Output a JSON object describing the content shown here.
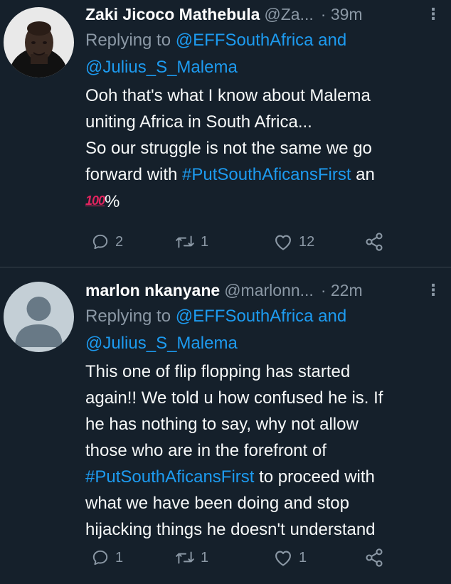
{
  "tweets": [
    {
      "name": "Zaki Jicoco Mathebula",
      "handle": "@Za...",
      "time": "· 39m",
      "more": "⋮",
      "replying_prefix": "Replying to ",
      "replying_to_1": "@EFFSouthAfrica",
      "replying_and": " and",
      "replying_to_2": "@Julius_S_Malema",
      "text_line_1": "Ooh that's what I know about Malema",
      "text_line_2": "uniting Africa in South Africa...",
      "text_line_3": "So our struggle is not the same we go",
      "text_line_4_prefix": "forward with ",
      "hashtag": "#PutSouthAficansFirst",
      "text_line_4_suffix": " an",
      "emoji": "100",
      "text_line_5_suffix": "%",
      "replies": "2",
      "retweets": "1",
      "likes": "12"
    },
    {
      "name": "marlon nkanyane",
      "handle": "@marlonn...",
      "time": "· 22m",
      "more": "⋮",
      "replying_prefix": "Replying to ",
      "replying_to_1": "@EFFSouthAfrica",
      "replying_and": " and",
      "replying_to_2": "@Julius_S_Malema",
      "text_line_1": "This one of flip flopping has started",
      "text_line_2": "again!! We told u how confused he is. If",
      "text_line_3": "he has nothing to say, why not allow",
      "text_line_4": "those who are in the forefront of",
      "hashtag": "#PutSouthAficansFirst",
      "text_line_5_suffix": " to proceed with",
      "text_line_6": "what we have been doing and stop",
      "text_line_7": "hijacking things he doesn't understand",
      "replies": "1",
      "retweets": "1",
      "likes": "1"
    }
  ],
  "colors": {
    "background": "#15202b",
    "link": "#1d9bf0",
    "secondary_text": "#8b98a5",
    "divider": "#38444d"
  },
  "icons": [
    "reply-icon",
    "retweet-icon",
    "like-icon",
    "share-icon",
    "more-icon",
    "avatar-photo",
    "default-avatar"
  ]
}
